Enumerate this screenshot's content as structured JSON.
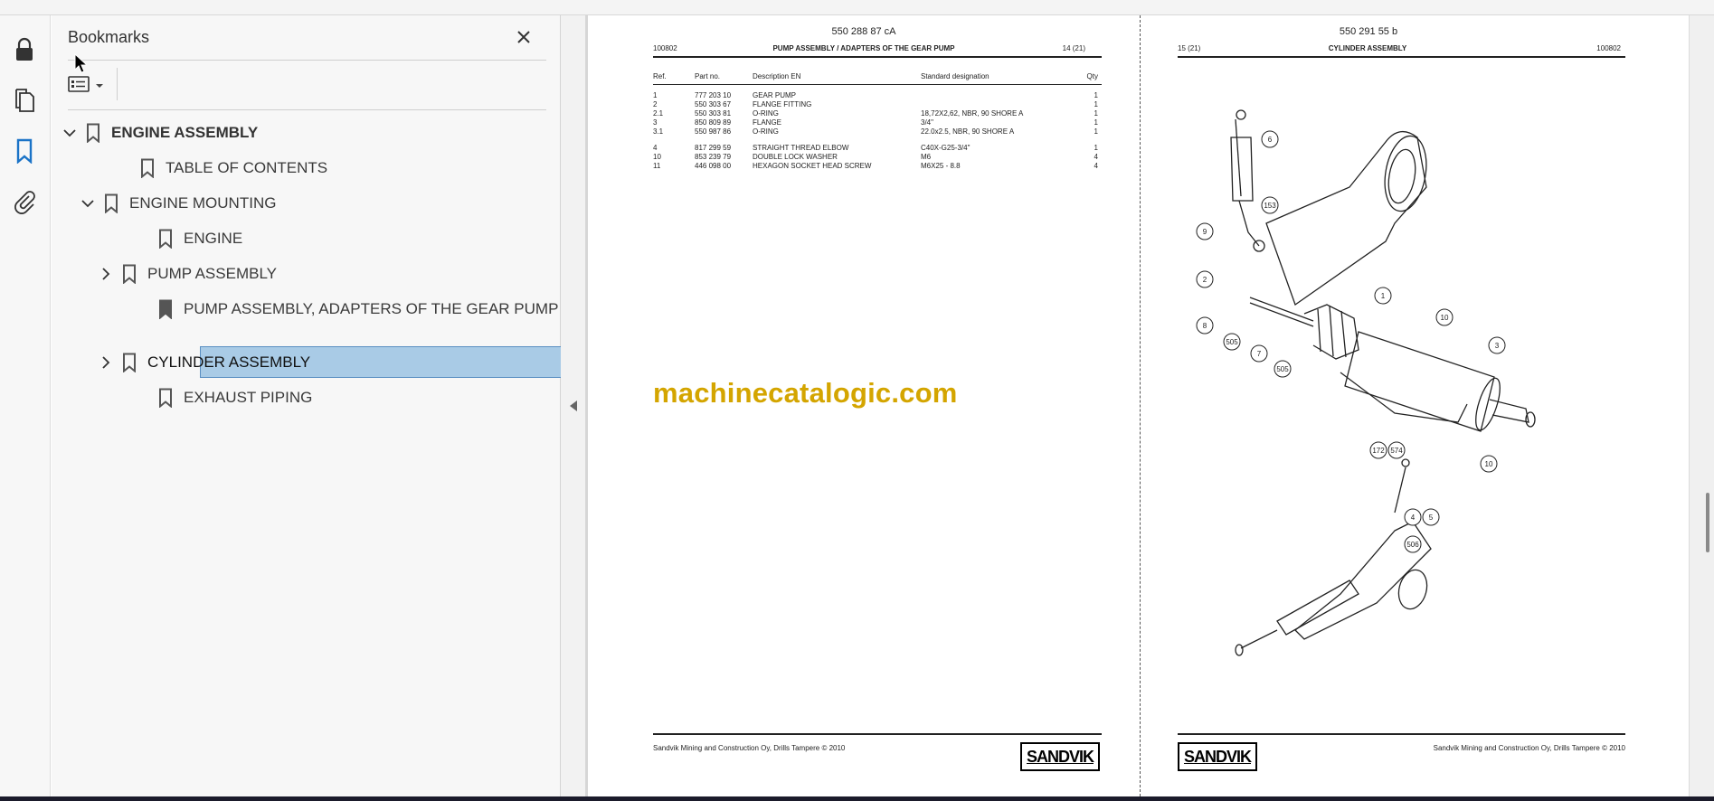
{
  "panel": {
    "title": "Bookmarks",
    "items": [
      {
        "label": "ENGINE ASSEMBLY"
      },
      {
        "label": "TABLE OF CONTENTS"
      },
      {
        "label": "ENGINE MOUNTING"
      },
      {
        "label": "ENGINE"
      },
      {
        "label": "PUMP ASSEMBLY"
      },
      {
        "label": "PUMP ASSEMBLY, ADAPTERS OF THE GEAR PUMP"
      },
      {
        "label": "CYLINDER ASSEMBLY"
      },
      {
        "label": "EXHAUST PIPING"
      }
    ],
    "selected": "CYLINDER ASSEMBLY"
  },
  "left_page": {
    "code": "550 288 87 cA",
    "doc_no": "100802",
    "title": "PUMP ASSEMBLY / ADAPTERS OF THE GEAR PUMP",
    "page": "14 (21)",
    "headers": [
      "Ref.",
      "Part no.",
      "Description EN",
      "Standard designation",
      "Qty"
    ],
    "rows": [
      [
        "1",
        "777 203 10",
        "GEAR PUMP",
        "",
        "1"
      ],
      [
        "2",
        "550 303 67",
        "FLANGE FITTING",
        "",
        "1"
      ],
      [
        "2.1",
        "550 303 81",
        "O-RING",
        "18,72X2,62, NBR, 90 SHORE A",
        "1"
      ],
      [
        "3",
        "850 809 89",
        "FLANGE",
        "3/4\"",
        "1"
      ],
      [
        "3.1",
        "550 987 86",
        "O-RING",
        "22.0x2.5, NBR, 90 SHORE A",
        "1"
      ],
      [
        "4",
        "817 299 59",
        "STRAIGHT THREAD ELBOW",
        "C40X-G25-3/4\"",
        "1"
      ],
      [
        "10",
        "853 239 79",
        "DOUBLE LOCK WASHER",
        "M6",
        "4"
      ],
      [
        "11",
        "446 098 00",
        "HEXAGON SOCKET HEAD SCREW",
        "M6X25 - 8.8",
        "4"
      ]
    ],
    "footer": "Sandvik Mining and Construction Oy, Drills Tampere © 2010",
    "logo": "SANDVIK"
  },
  "watermark": "machinecatalogic.com",
  "right_page": {
    "code": "550 291 55 b",
    "page": "15 (21)",
    "title": "CYLINDER ASSEMBLY",
    "doc_no": "100802",
    "callouts": [
      "6",
      "153",
      "9",
      "2",
      "1",
      "10",
      "8",
      "505",
      "7",
      "505",
      "3",
      "172",
      "574",
      "10",
      "4",
      "5",
      "506"
    ],
    "footer": "Sandvik Mining and Construction Oy, Drills Tampere © 2010",
    "logo": "SANDVIK"
  },
  "icons": [
    "lock-icon",
    "pages-icon",
    "bookmark-icon",
    "attachment-icon",
    "close-icon",
    "options-icon",
    "chevron-down-icon",
    "chevron-right-icon",
    "collapse-left-icon"
  ]
}
